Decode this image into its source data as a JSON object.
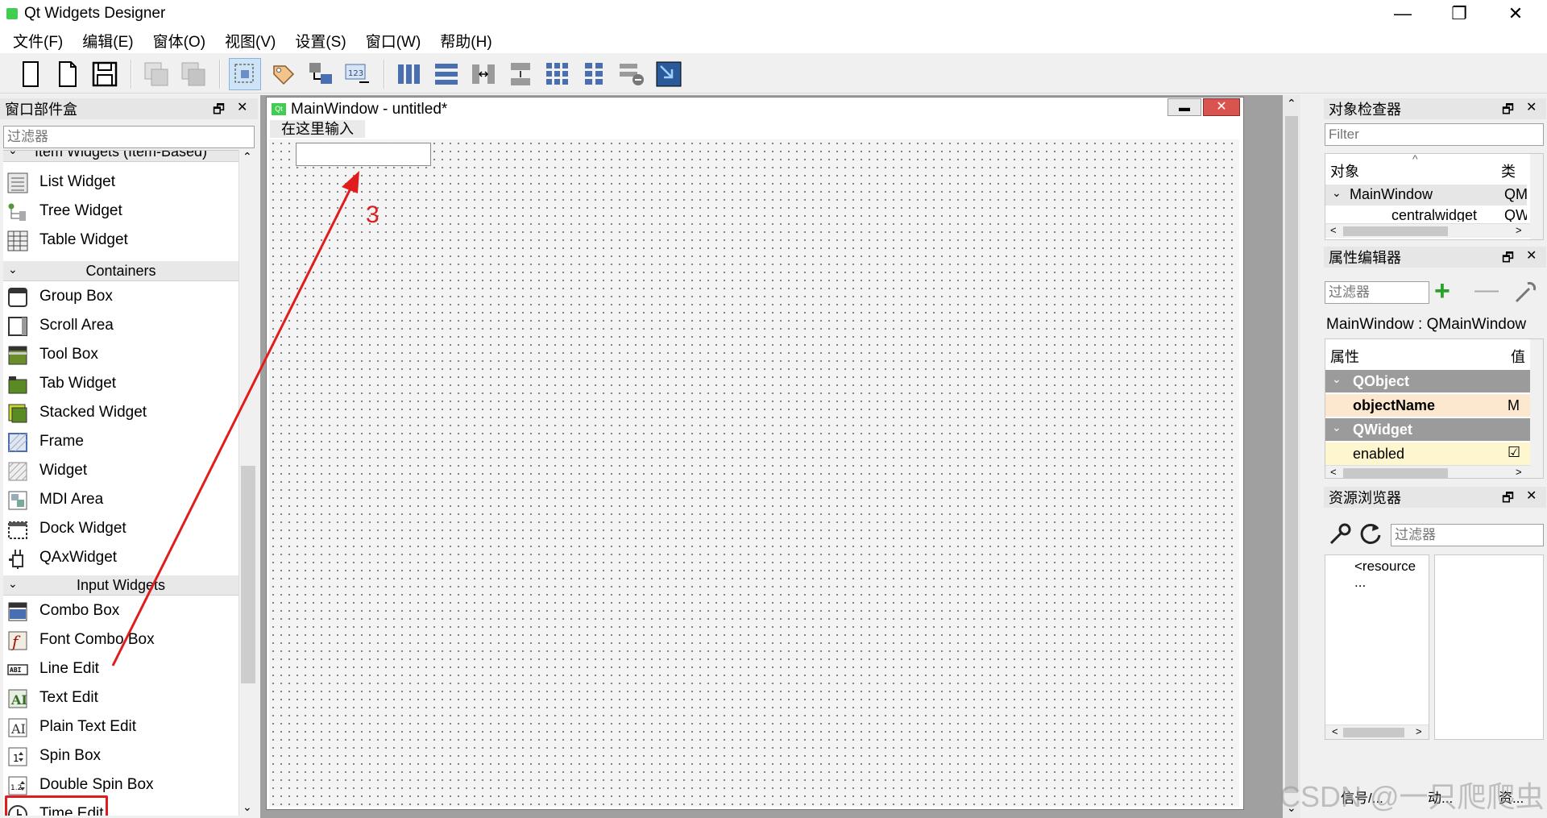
{
  "window": {
    "title": "Qt Widgets Designer",
    "controls": [
      "—",
      "❐",
      "✕"
    ]
  },
  "menu": [
    "文件(F)",
    "编辑(E)",
    "窗体(O)",
    "视图(V)",
    "设置(S)",
    "窗口(W)",
    "帮助(H)"
  ],
  "widget_box": {
    "title": "窗口部件盒",
    "filter_placeholder": "过滤器",
    "categories": {
      "item_widgets": "Item Widgets (Item-Based)",
      "containers": "Containers",
      "input_widgets": "Input Widgets"
    },
    "item_widgets": [
      "List Widget",
      "Tree Widget",
      "Table Widget"
    ],
    "containers": [
      "Group Box",
      "Scroll Area",
      "Tool Box",
      "Tab Widget",
      "Stacked Widget",
      "Frame",
      "Widget",
      "MDI Area",
      "Dock Widget",
      "QAxWidget"
    ],
    "input_widgets": [
      "Combo Box",
      "Font Combo Box",
      "Line Edit",
      "Text Edit",
      "Plain Text Edit",
      "Spin Box",
      "Double Spin Box",
      "Time Edit"
    ]
  },
  "form": {
    "title": "MainWindow - untitled*",
    "menu_placeholder": "在这里输入",
    "icon_label": "Qt"
  },
  "object_inspector": {
    "title": "对象检查器",
    "filter_placeholder": "Filter",
    "col_object": "对象",
    "col_class": "类",
    "rows": [
      {
        "name": "MainWindow",
        "class": "QM"
      },
      {
        "name": "centralwidget",
        "class": "QW"
      }
    ]
  },
  "property_editor": {
    "title": "属性编辑器",
    "filter_placeholder": "过滤器",
    "context": "MainWindow : QMainWindow",
    "col_property": "属性",
    "col_value": "值",
    "groups": [
      {
        "name": "QObject",
        "props": [
          {
            "name": "objectName",
            "value": "M"
          }
        ]
      },
      {
        "name": "QWidget",
        "props": [
          {
            "name": "enabled",
            "value": "☑"
          }
        ]
      }
    ]
  },
  "resource_browser": {
    "title": "资源浏览器",
    "filter_placeholder": "过滤器",
    "root": "<resource ..."
  },
  "bottom_tabs": [
    "信号/...",
    "动...",
    "资..."
  ],
  "annotation": {
    "step_number": "3",
    "color": "#e01c1c"
  },
  "watermark": "CSDN @一只爬爬虫"
}
